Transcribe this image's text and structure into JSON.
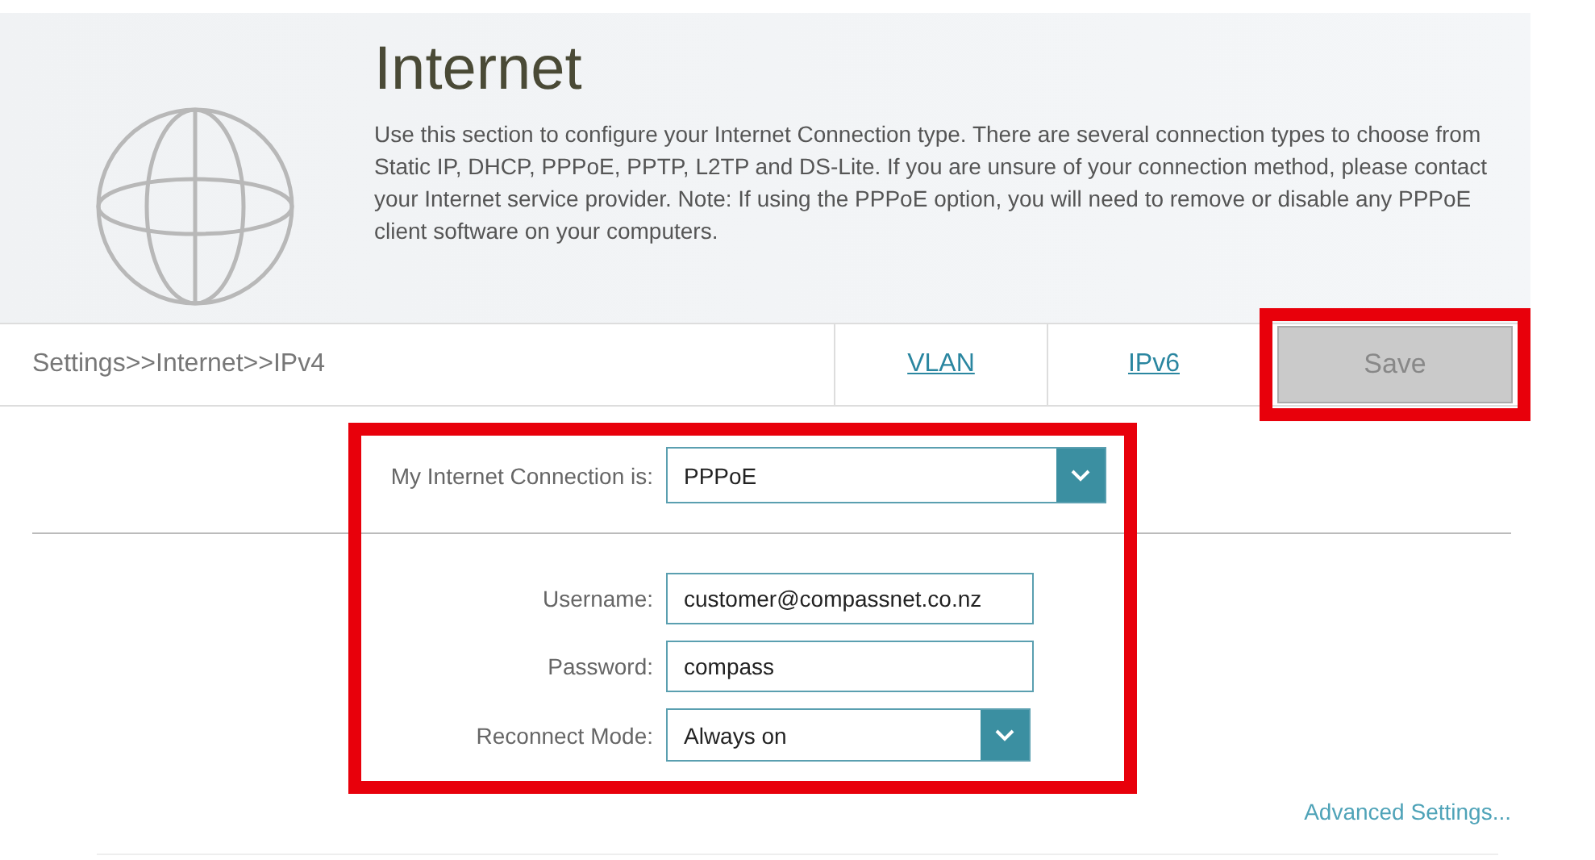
{
  "header": {
    "title": "Internet",
    "description": "Use this section to configure your Internet Connection type. There are several connection types to choose from Static IP, DHCP, PPPoE, PPTP, L2TP and DS-Lite. If you are unsure of your connection method, please contact your Internet service provider. Note: If using the PPPoE option, you will need to remove or disable any PPPoE client software on your computers."
  },
  "breadcrumb": "Settings>>Internet>>IPv4",
  "tabs": [
    {
      "label": "VLAN"
    },
    {
      "label": "IPv6"
    }
  ],
  "save": {
    "label": "Save",
    "highlighted": true
  },
  "form": {
    "highlighted": true,
    "connection": {
      "label": "My Internet Connection is:",
      "value": "PPPoE"
    },
    "fields": [
      {
        "kind": "text",
        "label": "Username:",
        "value": "customer@compassnet.co.nz"
      },
      {
        "kind": "text",
        "label": "Password:",
        "value": "compass"
      },
      {
        "kind": "select",
        "label": "Reconnect Mode:",
        "value": "Always on"
      }
    ]
  },
  "advanced_link": "Advanced Settings..."
}
